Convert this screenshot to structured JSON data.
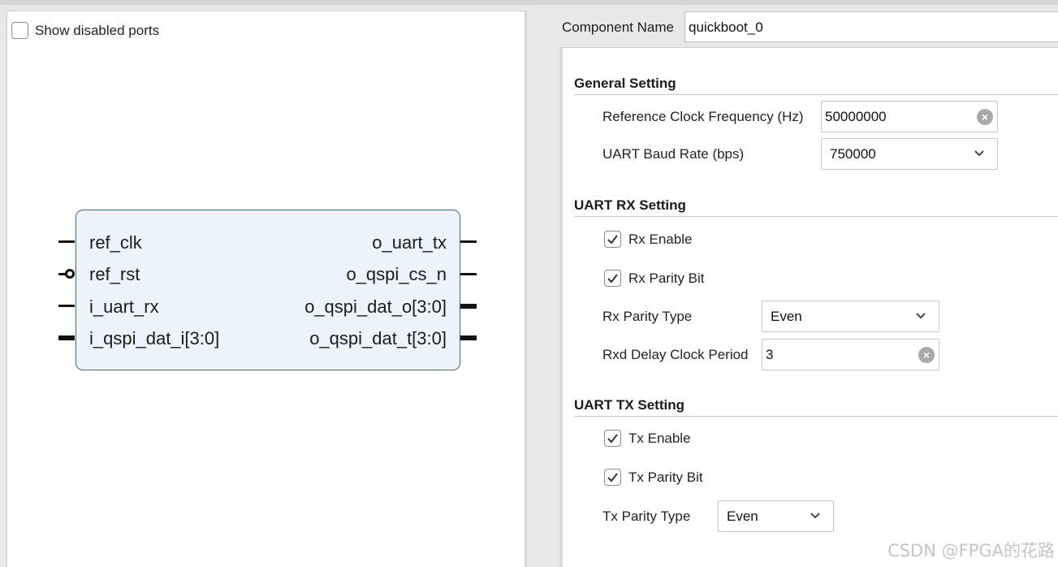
{
  "symbol_pane": {
    "show_disabled_ports": {
      "label": "Show disabled ports",
      "checked": false
    },
    "ip_block": {
      "inputs": [
        {
          "name": "ref_clk",
          "kind": "single"
        },
        {
          "name": "ref_rst",
          "kind": "active-low"
        },
        {
          "name": "i_uart_rx",
          "kind": "single"
        },
        {
          "name": "i_qspi_dat_i[3:0]",
          "kind": "bus"
        }
      ],
      "outputs": [
        {
          "name": "o_uart_tx",
          "kind": "single"
        },
        {
          "name": "o_qspi_cs_n",
          "kind": "single"
        },
        {
          "name": "o_qspi_dat_o[3:0]",
          "kind": "bus"
        },
        {
          "name": "o_qspi_dat_t[3:0]",
          "kind": "bus"
        }
      ]
    }
  },
  "config": {
    "component_name": {
      "label": "Component Name",
      "value": "quickboot_0"
    },
    "general": {
      "title": "General Setting",
      "ref_clk_freq": {
        "label": "Reference Clock Frequency (Hz)",
        "value": "50000000"
      },
      "uart_baud": {
        "label": "UART Baud Rate (bps)",
        "value": "750000"
      }
    },
    "rx": {
      "title": "UART RX Setting",
      "rx_enable": {
        "label": "Rx Enable",
        "checked": true
      },
      "rx_parity_bit": {
        "label": "Rx Parity Bit",
        "checked": true
      },
      "rx_parity_type": {
        "label": "Rx Parity Type",
        "value": "Even"
      },
      "rxd_delay": {
        "label": "Rxd Delay Clock Period",
        "value": "3"
      }
    },
    "tx": {
      "title": "UART TX Setting",
      "tx_enable": {
        "label": "Tx Enable",
        "checked": true
      },
      "tx_parity_bit": {
        "label": "Tx Parity Bit",
        "checked": true
      },
      "tx_parity_type": {
        "label": "Tx Parity Type",
        "value": "Even"
      }
    }
  },
  "icons": {
    "clear": "clear-circle-x-icon",
    "dropdown": "chevron-down-icon",
    "check": "checkmark-icon"
  },
  "colors": {
    "block_fill": "#edf3fa",
    "block_border": "#46648f",
    "pin": "#111111"
  },
  "watermark": "CSDN @FPGA的花路"
}
